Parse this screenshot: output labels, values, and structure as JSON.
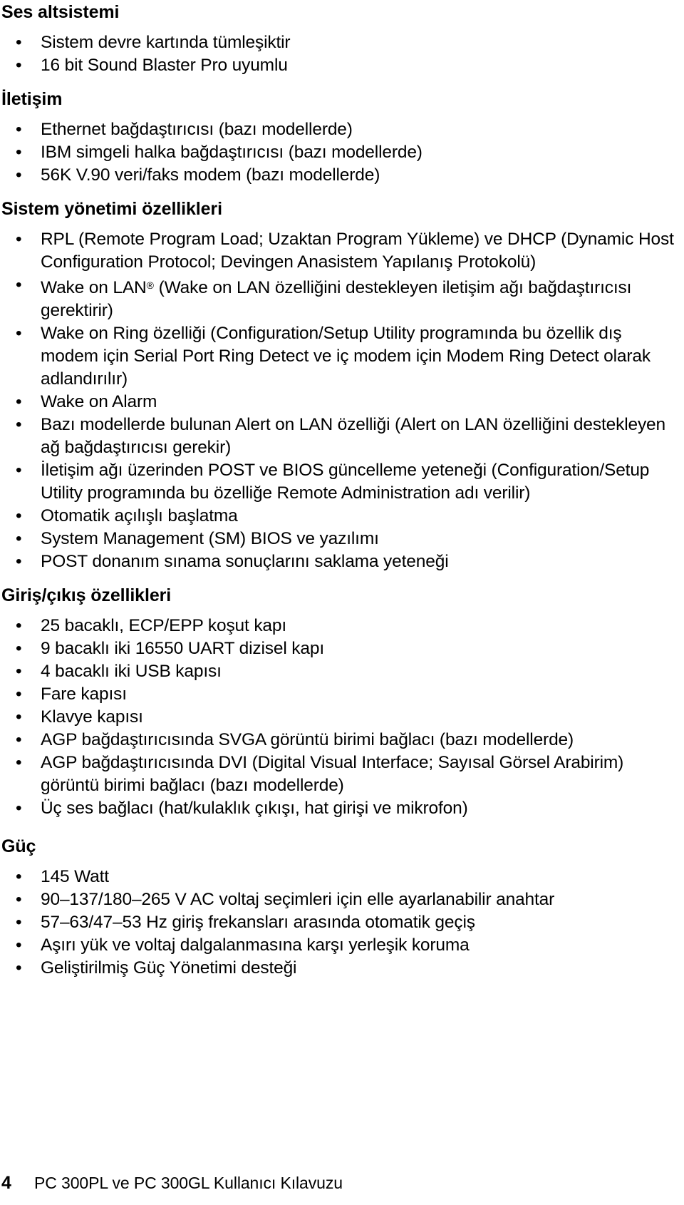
{
  "document": {
    "language": "tr",
    "page_number": "4",
    "footer_title": "PC 300PL ve PC 300GL Kullanıcı Kılavuzu"
  },
  "sections": [
    {
      "heading": "Ses altsistemi",
      "bullets": [
        "Sistem devre kartında tümleşiktir",
        "16 bit Sound Blaster Pro uyumlu"
      ]
    },
    {
      "heading": "İletişim",
      "bullets": [
        "Ethernet bağdaştırıcısı (bazı modellerde)",
        "IBM simgeli halka bağdaştırıcısı (bazı modellerde)",
        "56K V.90 veri/faks modem (bazı modellerde)"
      ]
    },
    {
      "heading": "Sistem yönetimi özellikleri",
      "bullets": [
        "RPL (Remote Program Load; Uzaktan Program Yükleme) ve DHCP (Dynamic Host Configuration Protocol; Devingen Anasistem Yapılanış Protokolü)",
        "Wake on LAN® (Wake on LAN özelliğini destekleyen iletişim ağı bağdaştırıcısı gerektirir)",
        "Wake on Ring özelliği (Configuration/Setup Utility programında bu özellik dış modem için Serial Port Ring Detect ve iç modem için Modem Ring Detect olarak adlandırılır)",
        "Wake on Alarm",
        "Bazı modellerde bulunan Alert on LAN özelliği (Alert on LAN özelliğini destekleyen ağ bağdaştırıcısı gerekir)",
        "İletişim ağı üzerinden POST ve BIOS güncelleme yeteneği (Configuration/Setup Utility programında bu özelliğe Remote Administration adı verilir)",
        "Otomatik açılışlı başlatma",
        "System Management (SM) BIOS ve yazılımı",
        "POST donanım sınama sonuçlarını saklama yeteneği"
      ]
    },
    {
      "heading": "Giriş/çıkış özellikleri",
      "bullets": [
        "25 bacaklı, ECP/EPP koşut kapı",
        "9 bacaklı iki 16550 UART dizisel kapı",
        "4 bacaklı iki USB kapısı",
        "Fare kapısı",
        "Klavye kapısı",
        "AGP bağdaştırıcısında SVGA görüntü birimi bağlacı (bazı modellerde)",
        "AGP bağdaştırıcısında DVI (Digital Visual Interface; Sayısal Görsel Arabirim) görüntü birimi bağlacı (bazı modellerde)",
        "Üç ses bağlacı (hat/kulaklık çıkışı, hat girişi ve mikrofon)"
      ]
    },
    {
      "heading": "Güç",
      "bullets": [
        "145 Watt",
        "90–137/180–265 V AC voltaj seçimleri için elle ayarlanabilir anahtar",
        "57–63/47–53 Hz giriş frekansları arasında otomatik  geçiş",
        "Aşırı yük ve voltaj dalgalanmasına karşı yerleşik koruma",
        "Geliştirilmiş Güç Yönetimi desteği"
      ]
    }
  ],
  "bullet_glyph": "•"
}
